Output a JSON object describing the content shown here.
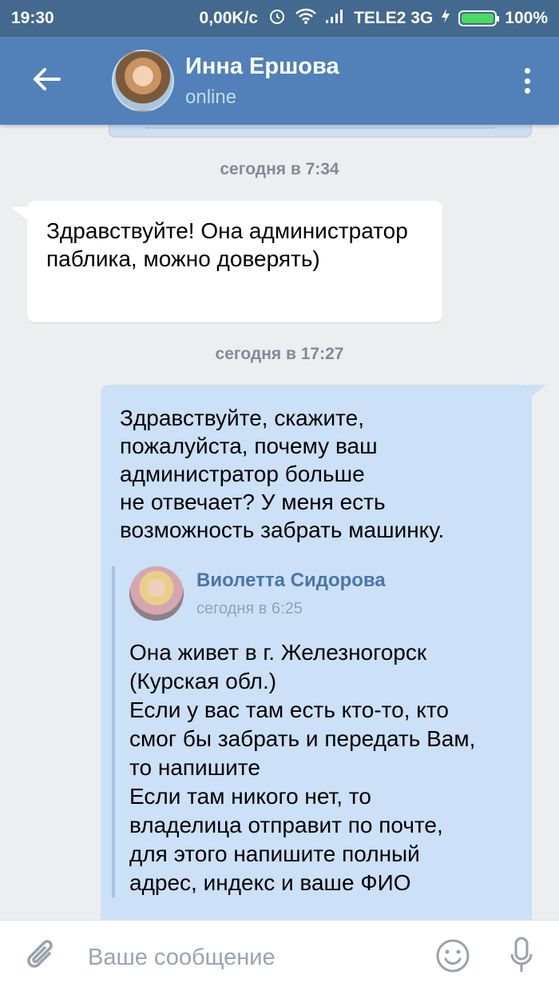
{
  "status_bar": {
    "time": "19:30",
    "net_speed": "0,00K/c",
    "carrier": "TELE2 3G",
    "battery": "100%"
  },
  "header": {
    "contact_name": "Инна Ершова",
    "contact_status": "online",
    "back_icon": "arrow-left-icon",
    "menu_icon": "more-vertical-icon"
  },
  "messages": {
    "sep1": "сегодня в 7:34",
    "incoming_text": "Здравствуйте! Она администратор паблика, можно доверять)",
    "sep2": "сегодня в 17:27",
    "outgoing_text": "Здравствуйте, скажите,\nпожалуйста, почему ваш\nадминистратор больше\nне отвечает? У меня есть\nвозможность забрать машинку.",
    "forwarded": {
      "author": "Виолетта Сидорова",
      "time": "сегодня в 6:25",
      "text": "Она живет в г. Железногорск\n(Курская обл.)\nЕсли у вас там есть кто-то, кто\nсмог бы забрать и передать Вам,\nто напишите\nЕсли там никого нет, то\nвладелица отправит по почте,\nдля этого напишите полный\nадрес, индекс и ваше ФИО"
    }
  },
  "composer": {
    "placeholder": "Ваше сообщение",
    "attach_icon": "paperclip-icon",
    "emoji_icon": "smile-icon",
    "mic_icon": "microphone-icon"
  },
  "colors": {
    "header": "#5181b8",
    "status_bar": "#43698e",
    "outgoing_bubble": "#cce0f7",
    "incoming_bubble": "#ffffff",
    "link": "#4a76a8"
  }
}
